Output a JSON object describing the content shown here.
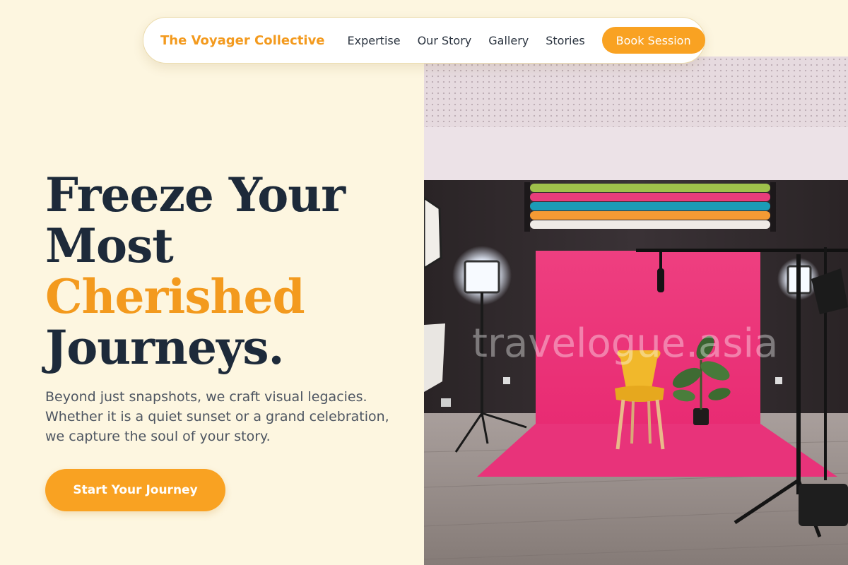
{
  "nav": {
    "brand": "The Voyager Collective",
    "links": [
      "Expertise",
      "Our Story",
      "Gallery",
      "Stories"
    ],
    "cta": "Book Session"
  },
  "hero": {
    "title_lines": [
      "Freeze Your",
      "Most",
      "Cherished",
      "Journeys."
    ],
    "subtitle": "Beyond just snapshots, we craft visual legacies. Whether it is a quiet sunset or a grand celebration, we capture the soul of your story.",
    "cta": "Start Your Journey",
    "watermark": "travelogue.asia"
  },
  "colors": {
    "accent": "#f9a222",
    "background": "#fdf6e0",
    "heading": "#1d2a3a"
  }
}
